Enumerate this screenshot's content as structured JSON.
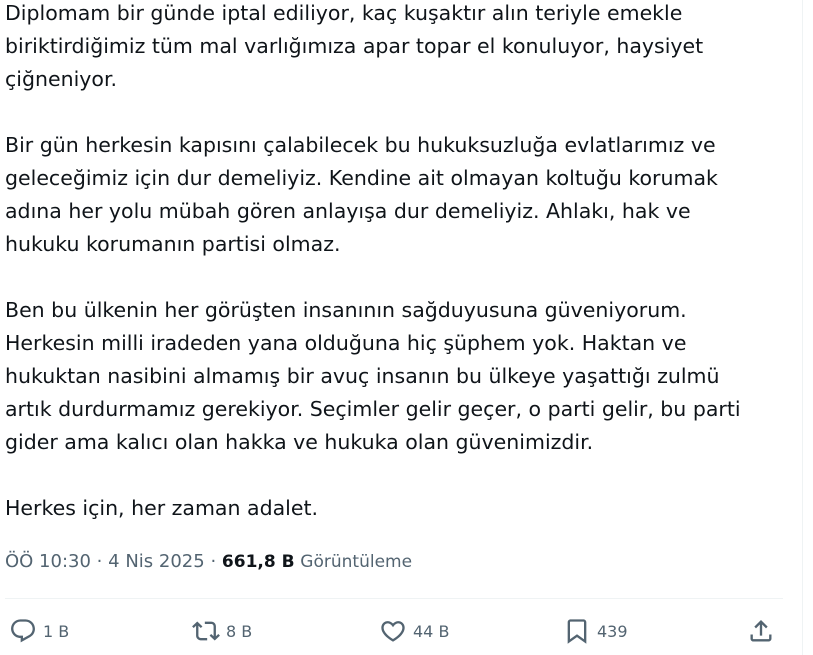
{
  "tweet": {
    "text": "Diplomam bir günde iptal ediliyor, kaç kuşaktır alın teriyle emekle\nbiriktirdiğimiz tüm mal varlığımıza apar topar el konuluyor, haysiyet\nçiğneniyor.\n\nBir gün herkesin kapısını çalabilecek bu hukuksuzluğa evlatlarımız ve\ngeleceğimiz için dur demeliyiz. Kendine ait olmayan koltuğu korumak\nadına her yolu mübah gören anlayışa dur demeliyiz. Ahlakı, hak ve\nhukuku korumanın partisi olmaz.\n\nBen bu ülkenin her görüşten insanının sağduyusuna güveniyorum.\nHerkesin milli iradeden yana olduğuna hiç şüphem yok. Haktan ve\nhukuktan nasibini almamış bir avuç insanın bu ülkeye yaşattığı zulmü\nartık durdurmamız gerekiyor. Seçimler gelir geçer, o parti gelir, bu parti\ngider ama kalıcı olan hakka ve hukuka olan güvenimizdir.\n\nHerkes için, her zaman adalet."
  },
  "meta": {
    "time": "ÖÖ 10:30",
    "separator": "·",
    "date": "4 Nis 2025",
    "views_count": "661,8 B",
    "views_label": "Görüntüleme"
  },
  "actions": {
    "reply": {
      "icon": "reply-icon",
      "count": "1 B"
    },
    "retweet": {
      "icon": "retweet-icon",
      "count": "8 B"
    },
    "like": {
      "icon": "heart-icon",
      "count": "44 B"
    },
    "bookmark": {
      "icon": "bookmark-icon",
      "count": "439"
    },
    "share": {
      "icon": "share-icon"
    }
  },
  "colors": {
    "text": "#0f1419",
    "secondary": "#536471",
    "divider": "#eff3f4"
  }
}
